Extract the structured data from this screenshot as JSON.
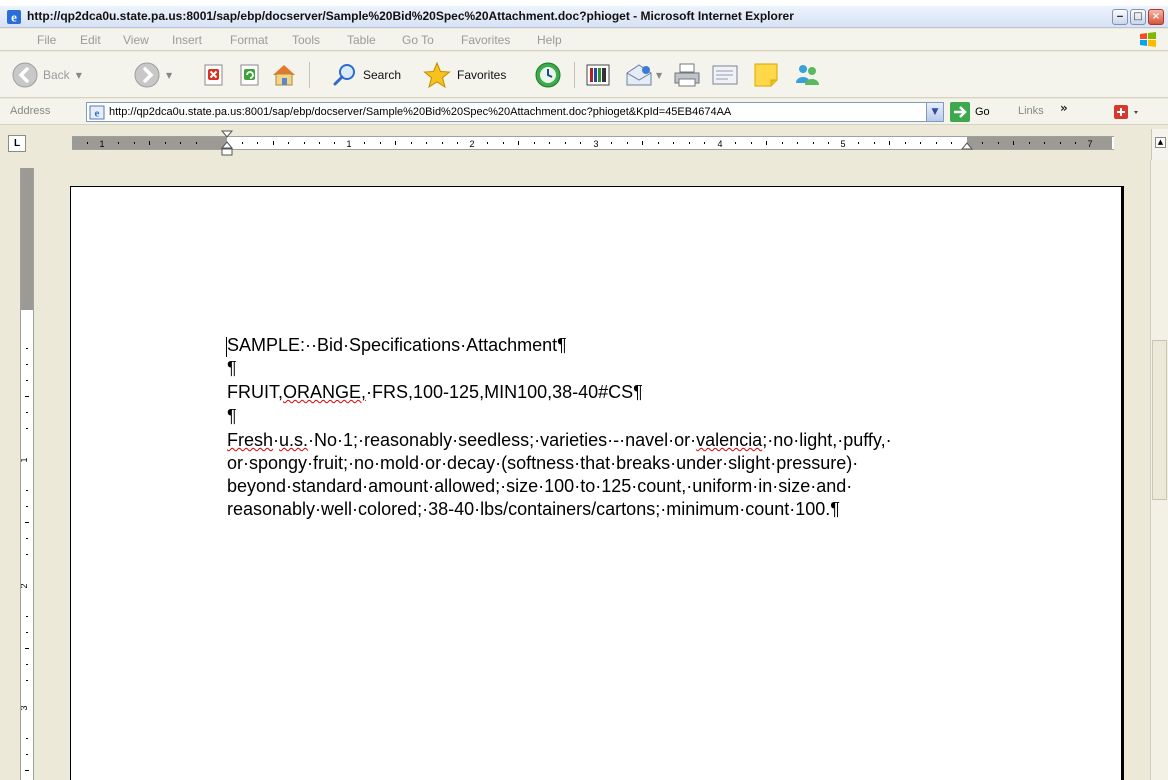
{
  "window": {
    "title": "http://qp2dca0u.state.pa.us:8001/sap/ebp/docserver/Sample%20Bid%20Spec%20Attachment.doc?phioget - Microsoft Internet Explorer",
    "minimize": "‒",
    "maximize": "□",
    "close": "×"
  },
  "menu": [
    "File",
    "Edit",
    "View",
    "Insert",
    "Format",
    "Tools",
    "Table",
    "Go To",
    "Favorites",
    "Help"
  ],
  "toolbar": {
    "back": "Back",
    "search": "Search",
    "favorites": "Favorites"
  },
  "address": {
    "label": "Address",
    "url": "http://qp2dca0u.state.pa.us:8001/sap/ebp/docserver/Sample%20Bid%20Spec%20Attachment.doc?phioget&KpId=45EB4674AA",
    "go": "Go",
    "links": "Links"
  },
  "ruler": {
    "tab_selector": "L",
    "numbers": [
      "1",
      "1",
      "2",
      "3",
      "4",
      "5",
      "7"
    ],
    "vertical_numbers": [
      "1",
      "1",
      "2",
      "3"
    ]
  },
  "document": {
    "line1": "SAMPLE:··Bid·Specifications·Attachment¶",
    "pilcrow1": "¶",
    "line2a": "FRUIT,",
    "line2b": "ORANGE,",
    "line2c": "·FRS,100-125,MIN100,38-40#CS¶",
    "pilcrow2": "¶",
    "p1a": "Fresh",
    "p1b": "·",
    "p1c": "u.s.",
    "p1d": "·No·1;·reasonably·seedless;·varieties·-·navel·or·",
    "p1e": "valencia",
    "p1f": ";·no·light,·puffy,·",
    "p2": "or·spongy·fruit;·no·mold·or·decay·(softness·that·breaks·under·slight·pressure)·",
    "p3": "beyond·standard·amount·allowed;·size·100·to·125·count,·uniform·in·size·and·",
    "p4": "reasonably·well·colored;·38-40·lbs/containers/cartons;·minimum·count·100.¶"
  }
}
